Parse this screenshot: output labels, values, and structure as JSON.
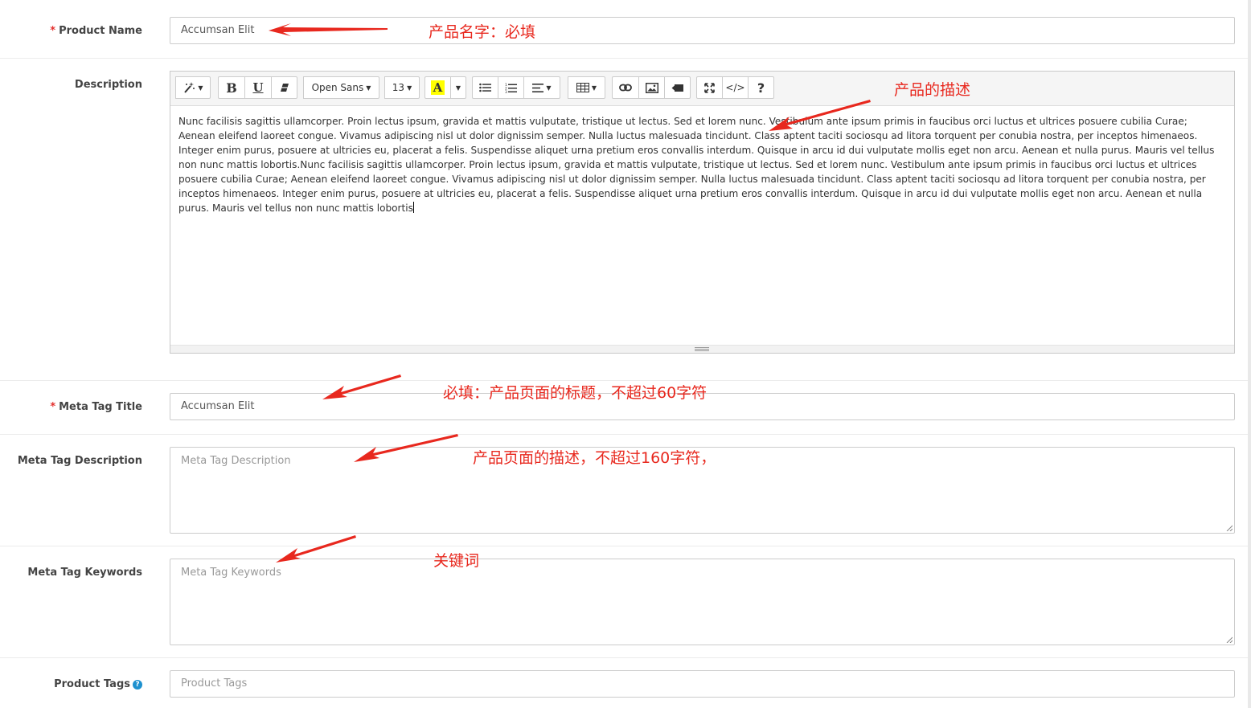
{
  "fields": {
    "product_name": {
      "label": "Product Name",
      "required_mark": "*",
      "value": "Accumsan Elit"
    },
    "description": {
      "label": "Description",
      "content": "Nunc facilisis sagittis ullamcorper. Proin lectus ipsum, gravida et mattis vulputate, tristique ut lectus. Sed et lorem nunc. Vestibulum ante ipsum primis in faucibus orci luctus et ultrices posuere cubilia Curae; Aenean eleifend laoreet congue. Vivamus adipiscing nisl ut dolor dignissim semper. Nulla luctus malesuada tincidunt. Class aptent taciti sociosqu ad litora torquent per conubia nostra, per inceptos himenaeos. Integer enim purus, posuere at ultricies eu, placerat a felis. Suspendisse aliquet urna pretium eros convallis interdum. Quisque in arcu id dui vulputate mollis eget non arcu. Aenean et nulla purus. Mauris vel tellus non nunc mattis lobortis.Nunc facilisis sagittis ullamcorper. Proin lectus ipsum, gravida et mattis vulputate, tristique ut lectus. Sed et lorem nunc. Vestibulum ante ipsum primis in faucibus orci luctus et ultrices posuere cubilia Curae; Aenean eleifend laoreet congue. Vivamus adipiscing nisl ut dolor dignissim semper. Nulla luctus malesuada tincidunt. Class aptent taciti sociosqu ad litora torquent per conubia nostra, per inceptos himenaeos. Integer enim purus, posuere at ultricies eu, placerat a felis. Suspendisse aliquet urna pretium eros convallis interdum. Quisque in arcu id dui vulputate mollis eget non arcu. Aenean et nulla purus. Mauris vel tellus non nunc mattis lobortis"
    },
    "meta_title": {
      "label": "Meta Tag Title",
      "required_mark": "*",
      "value": "Accumsan Elit"
    },
    "meta_description": {
      "label": "Meta Tag Description",
      "placeholder": "Meta Tag Description"
    },
    "meta_keywords": {
      "label": "Meta Tag Keywords",
      "placeholder": "Meta Tag Keywords"
    },
    "product_tags": {
      "label": "Product Tags",
      "placeholder": "Product Tags",
      "help_icon": "?"
    }
  },
  "toolbar": {
    "style_icon": "magic-wand-icon",
    "bold": "B",
    "underline": "U",
    "eraser_icon": "eraser-icon",
    "font_family": "Open Sans",
    "font_size": "13",
    "color_letter": "A",
    "highlight_color": "#ffff00",
    "codeview": "</>",
    "help": "?"
  },
  "annotations": {
    "product_name": "产品名字：必填",
    "description": "产品的描述",
    "meta_title": "必填：产品页面的标题，不超过60字符",
    "meta_description": "产品页面的描述，不超过160字符，",
    "meta_keywords": "关键词",
    "color": "#e8281e"
  },
  "colors": {
    "required": "#e3302d",
    "help_icon": "#1e91cf"
  }
}
